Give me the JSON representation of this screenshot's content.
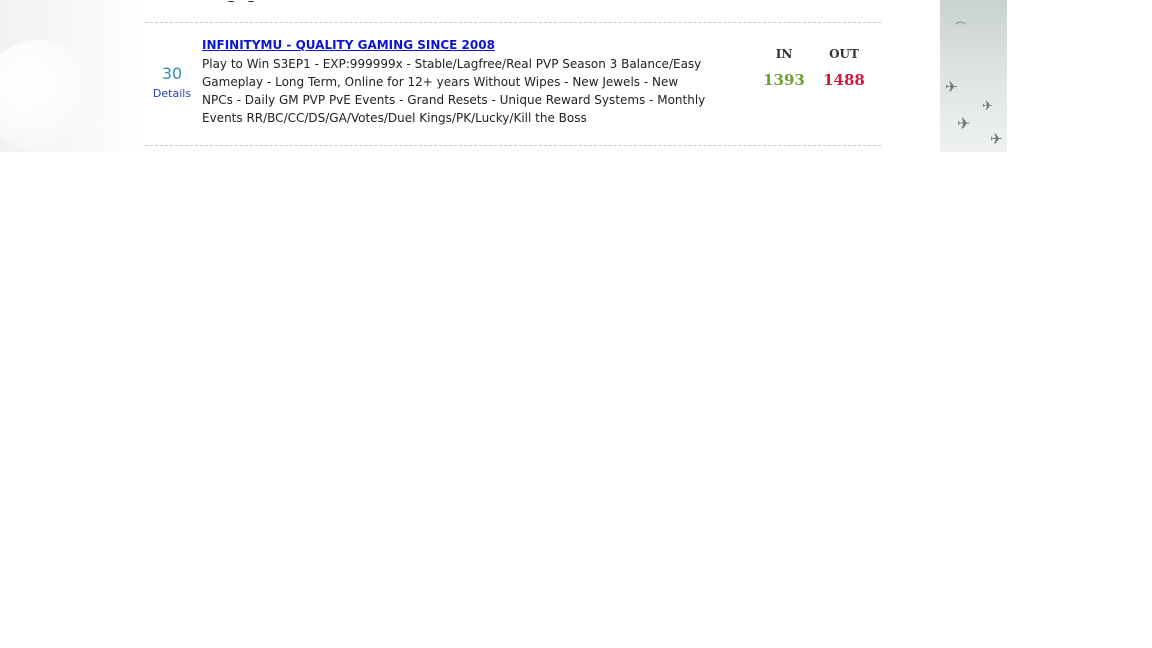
{
  "server": {
    "rank": "30",
    "details_label": "Details",
    "title": "INFINITYMU - QUALITY GAMING SINCE 2008",
    "description": "Play to Win S3EP1 - EXP:999999x - Stable/Lagfree/Real PVP Season 3 Balance/Easy Gameplay - Long Term, Online for 12+ years Without Wipes - New Jewels - New NPCs - Daily GM PVP PvE Events - Grand Resets - Unique Reward Systems - Monthly Events RR/BC/CC/DS/GA/Votes/Duel Kings/PK/Lucky/Kill the Boss"
  },
  "stats": {
    "in_label": "IN",
    "out_label": "OUT",
    "in_value": "1393",
    "out_value": "1488"
  },
  "colors": {
    "title_link": "#0b14d6",
    "rank": "#2e8fb3",
    "details_link": "#1f3fc0",
    "in_value": "#6e9f2e",
    "out_value": "#cc1a3f",
    "divider": "#c8c8c8"
  },
  "icons": {
    "background_birds": "bird-icon"
  }
}
